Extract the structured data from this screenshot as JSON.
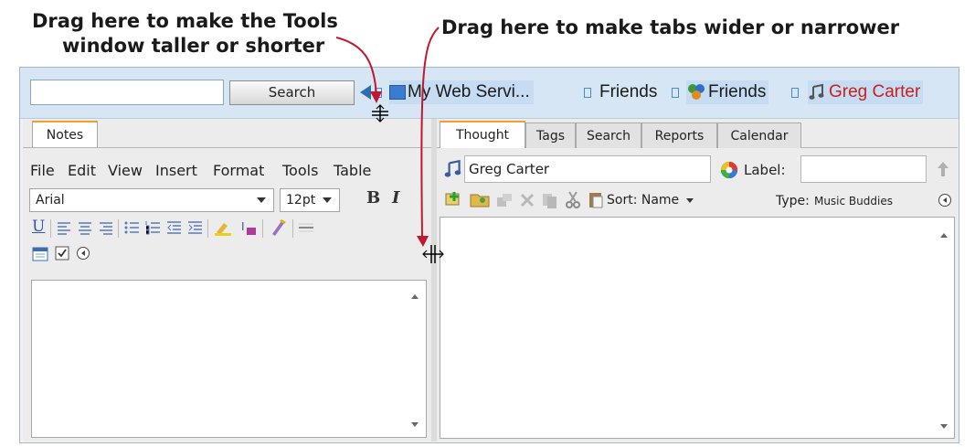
{
  "annotations": {
    "tools_line1": "Drag here to make the Tools",
    "tools_line2": "window taller or shorter",
    "tabs": "Drag here to make tabs wider or narrower",
    "arrow_color": "#c0182e"
  },
  "topbar": {
    "search_value": "",
    "search_button": "Search",
    "breadcrumbs": [
      "My Web Servi...",
      "Friends",
      "Friends",
      "Greg Carter"
    ],
    "highlight_color": "#c6dcf3",
    "active_color": "#c8201a"
  },
  "left_pane": {
    "tab": "Notes",
    "menu": [
      "File",
      "Edit",
      "View",
      "Insert",
      "Format",
      "Tools",
      "Table"
    ],
    "font": "Arial",
    "size": "12pt",
    "bold": "B",
    "italic": "I",
    "underline": "U"
  },
  "right_pane": {
    "tabs": [
      "Thought",
      "Tags",
      "Search",
      "Reports",
      "Calendar"
    ],
    "thought_name": "Greg Carter",
    "label_text": "Label:",
    "label_value": "",
    "sort_text": "Sort: Name",
    "type_label": "Type:",
    "type_value": "Music Buddies"
  },
  "colors": {
    "accent": "#2a6fb0",
    "tab_active_top": "#f0a030"
  }
}
